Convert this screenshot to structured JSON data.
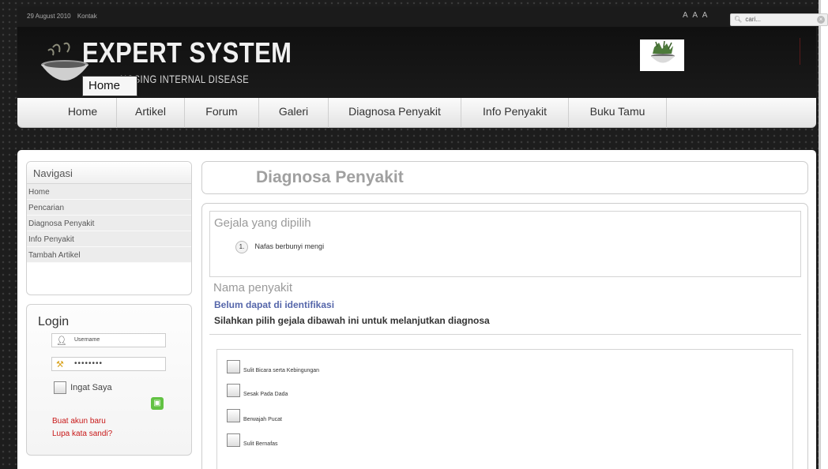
{
  "topbar": {
    "date": "29 August 2010",
    "contact": "Kontak",
    "font_sizer": "A A A",
    "search_placeholder": "cari..."
  },
  "header": {
    "title": "EXPERT SYSTEM",
    "subtitle": "NOSING INTERNAL DISEASE",
    "tooltip": "Home"
  },
  "nav": {
    "items": [
      "Home",
      "Artikel",
      "Forum",
      "Galeri",
      "Diagnosa Penyakit",
      "Info Penyakit",
      "Buku Tamu"
    ]
  },
  "sidebar": {
    "title": "Navigasi",
    "items": [
      "Home",
      "Pencarian",
      "Diagnosa Penyakit",
      "Info Penyakit",
      "Tambah Artikel"
    ]
  },
  "login": {
    "title": "Login",
    "username_placeholder": "Username",
    "password_value": "••••••••",
    "remember_label": "Ingat Saya",
    "create_account": "Buat akun baru",
    "forgot_password": "Lupa kata sandi?"
  },
  "main": {
    "page_title": "Diagnosa Penyakit",
    "selected_title": "Gejala yang dipilih",
    "selected_symptoms": [
      {
        "number": "1.",
        "text": "Nafas berbunyi mengi"
      }
    ],
    "disease_title": "Nama penyakit",
    "disease_status": "Belum dapat di identifikasi",
    "instruction": "Silahkan pilih gejala dibawah ini untuk melanjutkan diagnosa",
    "symptom_options": [
      "Sulit Bicara serta Kebingungan",
      "Sesak Pada Dada",
      "Berwajah Pucat",
      "Sulit Bernafas"
    ]
  },
  "colors": {
    "status_blue": "#5566aa",
    "link_red": "#c81818",
    "title_gray": "#a0a0a0"
  }
}
